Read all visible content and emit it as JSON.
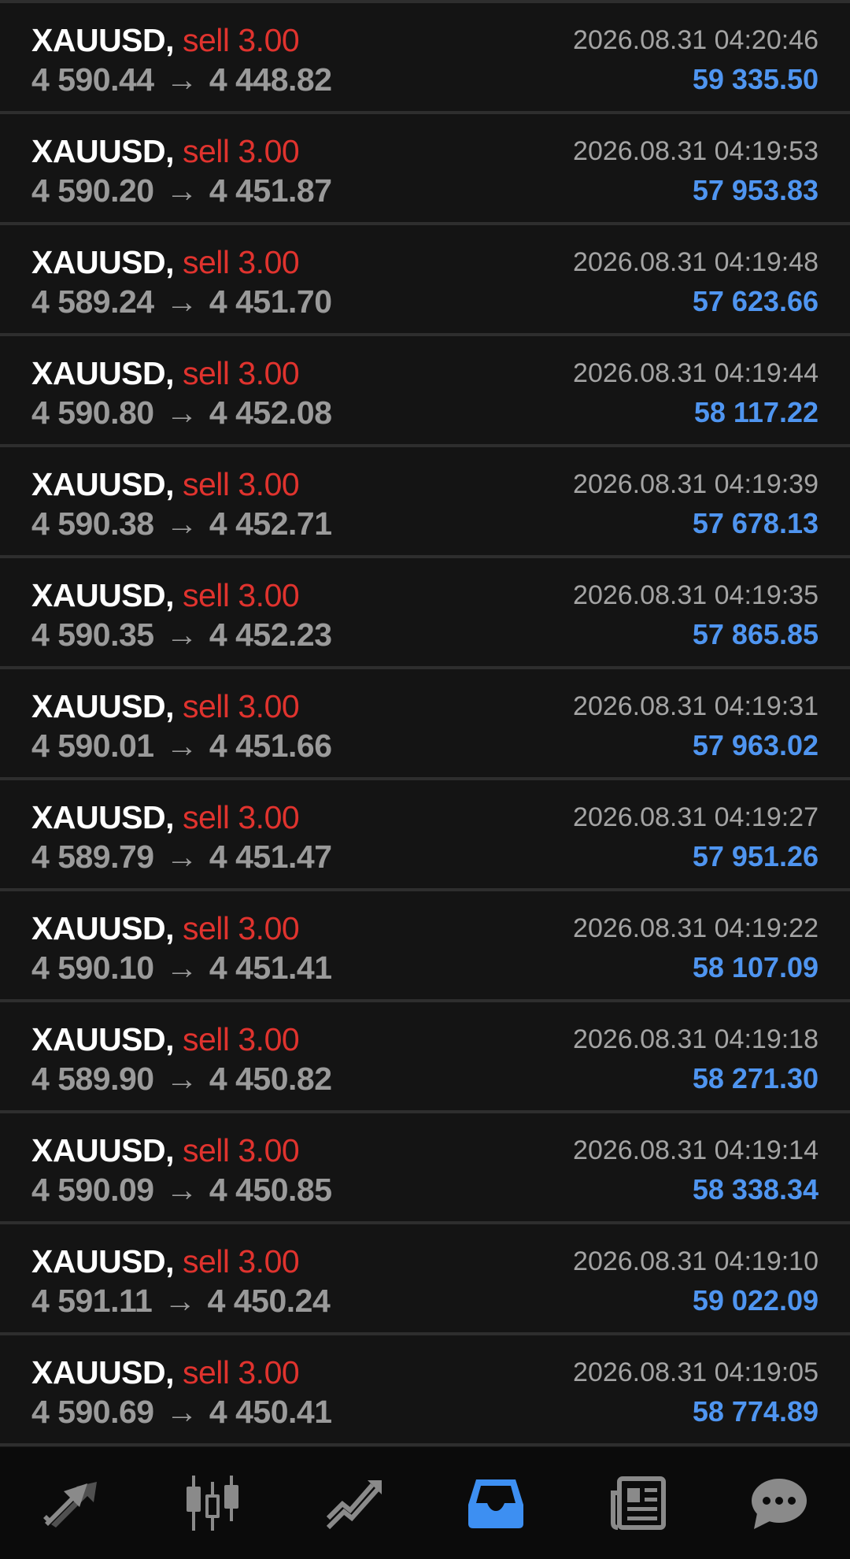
{
  "rows": [
    {
      "symbol": "XAUUSD,",
      "side": "sell",
      "volume": "3.00",
      "open": "4 590.44",
      "close": "4 448.82",
      "time": "2026.08.31 04:20:46",
      "profit": "59 335.50"
    },
    {
      "symbol": "XAUUSD,",
      "side": "sell",
      "volume": "3.00",
      "open": "4 590.20",
      "close": "4 451.87",
      "time": "2026.08.31 04:19:53",
      "profit": "57 953.83"
    },
    {
      "symbol": "XAUUSD,",
      "side": "sell",
      "volume": "3.00",
      "open": "4 589.24",
      "close": "4 451.70",
      "time": "2026.08.31 04:19:48",
      "profit": "57 623.66"
    },
    {
      "symbol": "XAUUSD,",
      "side": "sell",
      "volume": "3.00",
      "open": "4 590.80",
      "close": "4 452.08",
      "time": "2026.08.31 04:19:44",
      "profit": "58 117.22"
    },
    {
      "symbol": "XAUUSD,",
      "side": "sell",
      "volume": "3.00",
      "open": "4 590.38",
      "close": "4 452.71",
      "time": "2026.08.31 04:19:39",
      "profit": "57 678.13"
    },
    {
      "symbol": "XAUUSD,",
      "side": "sell",
      "volume": "3.00",
      "open": "4 590.35",
      "close": "4 452.23",
      "time": "2026.08.31 04:19:35",
      "profit": "57 865.85"
    },
    {
      "symbol": "XAUUSD,",
      "side": "sell",
      "volume": "3.00",
      "open": "4 590.01",
      "close": "4 451.66",
      "time": "2026.08.31 04:19:31",
      "profit": "57 963.02"
    },
    {
      "symbol": "XAUUSD,",
      "side": "sell",
      "volume": "3.00",
      "open": "4 589.79",
      "close": "4 451.47",
      "time": "2026.08.31 04:19:27",
      "profit": "57 951.26"
    },
    {
      "symbol": "XAUUSD,",
      "side": "sell",
      "volume": "3.00",
      "open": "4 590.10",
      "close": "4 451.41",
      "time": "2026.08.31 04:19:22",
      "profit": "58 107.09"
    },
    {
      "symbol": "XAUUSD,",
      "side": "sell",
      "volume": "3.00",
      "open": "4 589.90",
      "close": "4 450.82",
      "time": "2026.08.31 04:19:18",
      "profit": "58 271.30"
    },
    {
      "symbol": "XAUUSD,",
      "side": "sell",
      "volume": "3.00",
      "open": "4 590.09",
      "close": "4 450.85",
      "time": "2026.08.31 04:19:14",
      "profit": "58 338.34"
    },
    {
      "symbol": "XAUUSD,",
      "side": "sell",
      "volume": "3.00",
      "open": "4 591.11",
      "close": "4 450.24",
      "time": "2026.08.31 04:19:10",
      "profit": "59 022.09"
    },
    {
      "symbol": "XAUUSD,",
      "side": "sell",
      "volume": "3.00",
      "open": "4 590.69",
      "close": "4 450.41",
      "time": "2026.08.31 04:19:05",
      "profit": "58 774.89"
    }
  ],
  "arrow_glyph": "→",
  "nav": {
    "items": [
      "quotes-icon",
      "chart-icon",
      "trade-icon",
      "history-icon",
      "news-icon",
      "messages-icon"
    ],
    "active": "history-icon"
  },
  "colors": {
    "background": "#141414",
    "divider": "#2e2e2e",
    "symbol": "#ffffff",
    "sell": "#e0332e",
    "price": "#9a9a9a",
    "profit": "#4f95f0",
    "nav_icon": "#8a8a8a",
    "nav_active": "#3d8ff2"
  }
}
